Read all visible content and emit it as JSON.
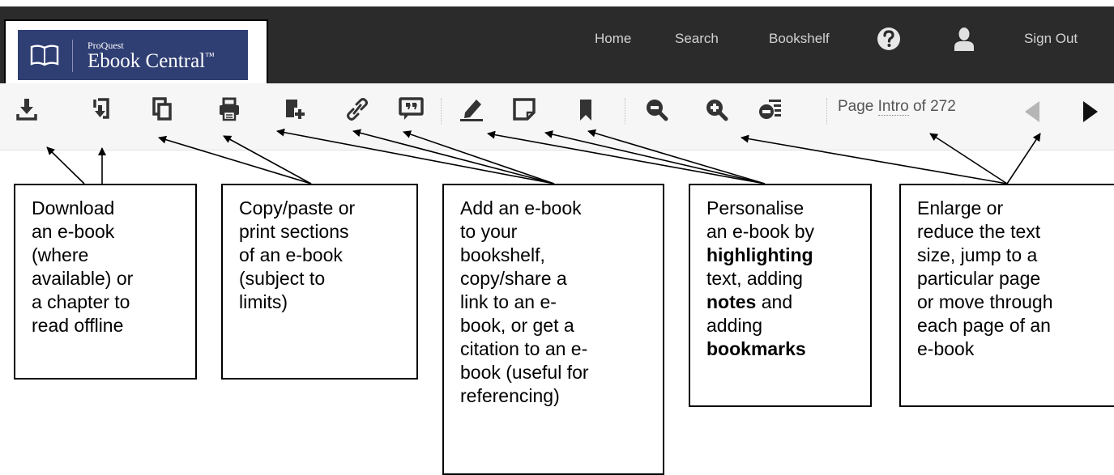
{
  "header": {
    "logo": {
      "publisher": "ProQuest",
      "product": "Ebook Central",
      "trademark": "™"
    },
    "nav": {
      "home": "Home",
      "search": "Search",
      "bookshelf": "Bookshelf",
      "sign_out": "Sign Out"
    },
    "icons": [
      "help-icon",
      "user-icon"
    ]
  },
  "toolbar": {
    "icons": [
      "download-book-icon",
      "download-chapter-icon",
      "copy-icon",
      "print-icon",
      "add-to-bookshelf-icon",
      "share-link-icon",
      "citation-icon",
      "highlight-icon",
      "note-icon",
      "bookmark-icon",
      "zoom-out-icon",
      "zoom-in-icon",
      "fit-page-icon",
      "previous-page-icon",
      "next-page-icon"
    ],
    "page_label": "Page",
    "page_current": "Intro",
    "page_of": "of 272"
  },
  "callouts": {
    "download": [
      "Download",
      "an e-book",
      "(where",
      "available) or",
      "a chapter to",
      "read offline"
    ],
    "copy": [
      "Copy/paste or",
      "print sections",
      "of an e-book",
      "(subject to",
      "limits)"
    ],
    "add": [
      "Add an e-book",
      "to your",
      "bookshelf,",
      "copy/share a",
      "link to an e-",
      "book, or get a",
      "citation to an e-",
      "book (useful for",
      "referencing)"
    ],
    "personalise": {
      "l1": "Personalise",
      "l2": "an e-book by",
      "highlighting": "highlighting",
      "text_adding": "text, adding",
      "notes": "notes",
      "and": " and",
      "adding": "adding",
      "bookmarks": "bookmarks"
    },
    "enlarge": [
      "Enlarge or",
      "reduce the text",
      "size, jump to a",
      "particular page",
      "or move through",
      "each page of an",
      "e-book"
    ]
  },
  "colors": {
    "header_bg": "#2b2b2b",
    "logo_bg": "#2f3e73",
    "toolbar_bg": "#f6f6f6",
    "icon_color": "#333333",
    "page_arrow_disabled": "#b5b5b5"
  }
}
